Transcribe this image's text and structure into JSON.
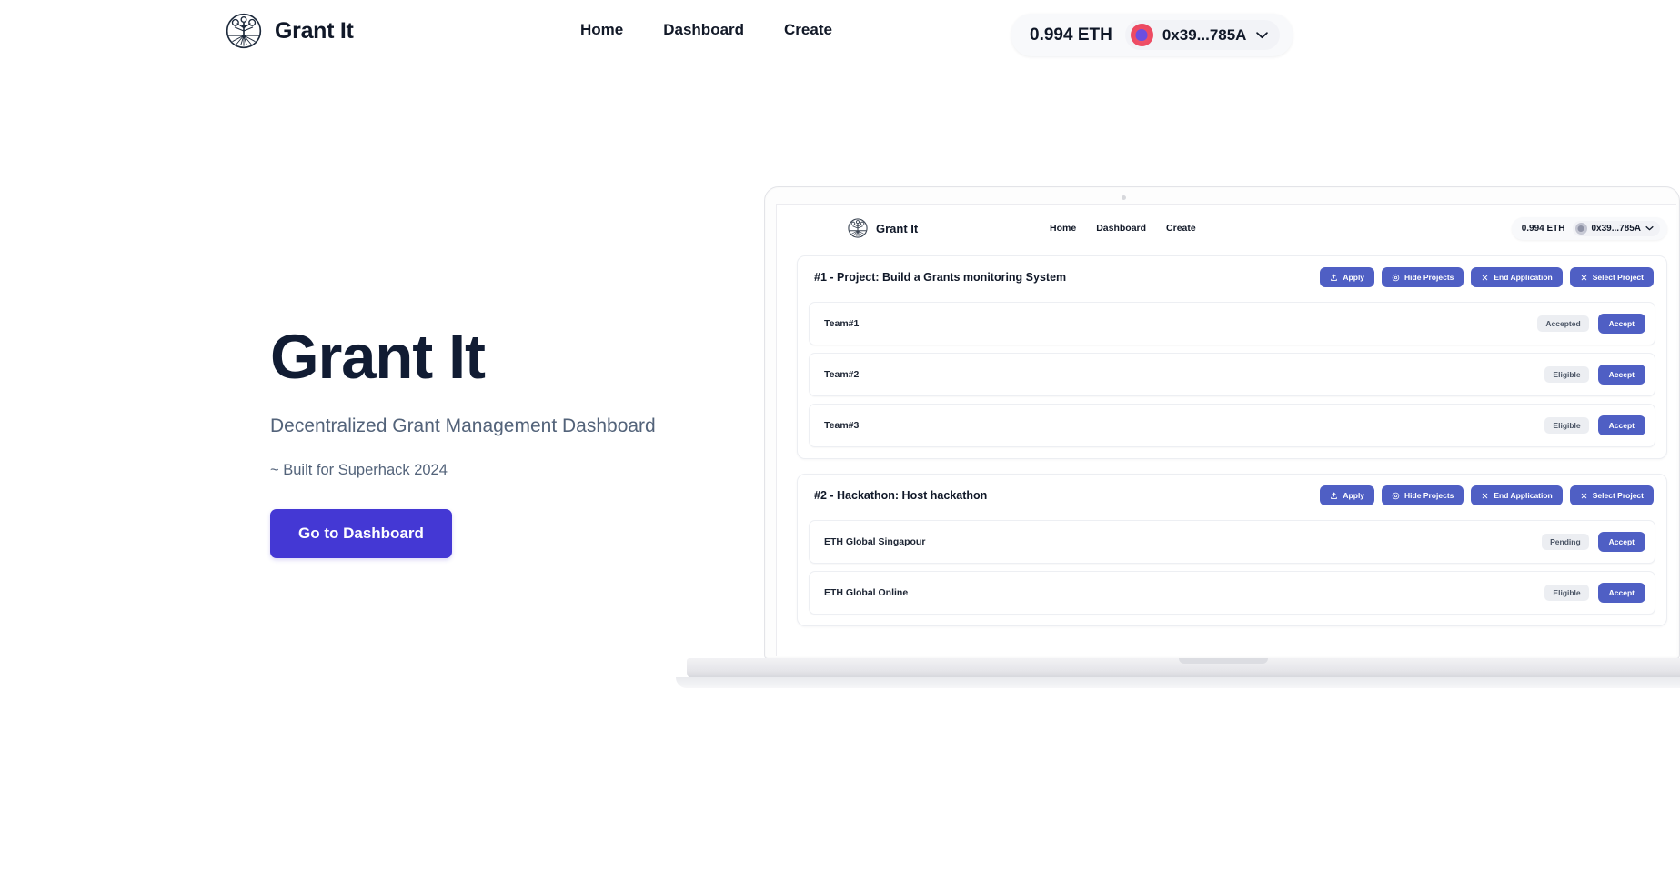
{
  "navbar": {
    "brand": "Grant It",
    "logo_icon": "tree-circle-logo-icon",
    "links": [
      {
        "label": "Home"
      },
      {
        "label": "Dashboard"
      },
      {
        "label": "Create"
      }
    ],
    "wallet": {
      "balance": "0.994 ETH",
      "address": "0x39...785A",
      "avatar_icon": "wallet-avatar-icon",
      "chevron_icon": "chevron-down-icon"
    }
  },
  "hero": {
    "title": "Grant It",
    "subtitle": "Decentralized Grant Management Dashboard",
    "tagline": "~ Built for Superhack 2024",
    "cta_label": "Go to Dashboard",
    "cta_color": "#4438d4"
  },
  "mockup": {
    "device": "laptop",
    "app": {
      "navbar": {
        "brand": "Grant It",
        "logo_icon": "tree-circle-logo-icon",
        "links": [
          {
            "label": "Home"
          },
          {
            "label": "Dashboard"
          },
          {
            "label": "Create"
          }
        ],
        "wallet": {
          "balance": "0.994 ETH",
          "address": "0x39...785A",
          "avatar_icon": "wallet-avatar-icon",
          "chevron_icon": "chevron-down-icon"
        }
      },
      "cards": [
        {
          "title": "#1 - Project: Build a Grants monitoring System",
          "actions": [
            {
              "label": "Apply",
              "icon": "upload-icon"
            },
            {
              "label": "Hide Projects",
              "icon": "eye-icon"
            },
            {
              "label": "End Application",
              "icon": "close-icon"
            },
            {
              "label": "Select Project",
              "icon": "close-icon"
            }
          ],
          "rows": [
            {
              "name": "Team#1",
              "status": "Accepted",
              "action_label": "Accept"
            },
            {
              "name": "Team#2",
              "status": "Eligible",
              "action_label": "Accept"
            },
            {
              "name": "Team#3",
              "status": "Eligible",
              "action_label": "Accept"
            }
          ]
        },
        {
          "title": "#2 - Hackathon: Host hackathon",
          "actions": [
            {
              "label": "Apply",
              "icon": "upload-icon"
            },
            {
              "label": "Hide Projects",
              "icon": "eye-icon"
            },
            {
              "label": "End Application",
              "icon": "close-icon"
            },
            {
              "label": "Select Project",
              "icon": "close-icon"
            }
          ],
          "rows": [
            {
              "name": "ETH Global Singapour",
              "status": "Pending",
              "action_label": "Accept"
            },
            {
              "name": "ETH Global Online",
              "status": "Eligible",
              "action_label": "Accept"
            }
          ]
        }
      ]
    }
  },
  "colors": {
    "accent": "#4438d4",
    "button_blue": "#4f5fc4",
    "heading": "#111c33",
    "muted_text": "#53637a"
  }
}
